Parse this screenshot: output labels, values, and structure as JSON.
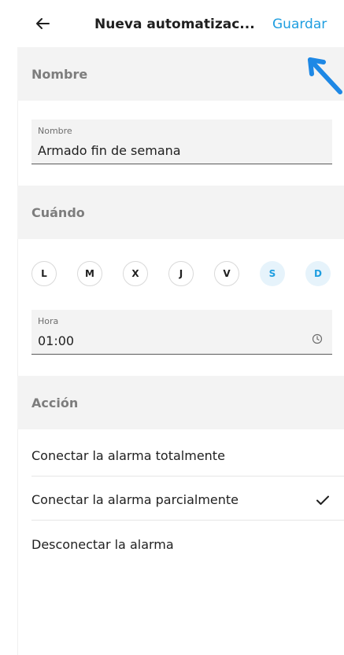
{
  "header": {
    "title": "Nueva automatizac...",
    "save_label": "Guardar"
  },
  "name_section": {
    "header": "Nombre",
    "field_label": "Nombre",
    "field_value": "Armado fin de semana"
  },
  "when_section": {
    "header": "Cuándo",
    "days": [
      {
        "label": "L",
        "selected": false
      },
      {
        "label": "M",
        "selected": false
      },
      {
        "label": "X",
        "selected": false
      },
      {
        "label": "J",
        "selected": false
      },
      {
        "label": "V",
        "selected": false
      },
      {
        "label": "S",
        "selected": true
      },
      {
        "label": "D",
        "selected": true
      }
    ],
    "time_label": "Hora",
    "time_value": "01:00"
  },
  "action_section": {
    "header": "Acción",
    "items": [
      {
        "label": "Conectar la alarma totalmente",
        "selected": false
      },
      {
        "label": "Conectar la alarma parcialmente",
        "selected": true
      },
      {
        "label": "Desconectar la alarma",
        "selected": false
      }
    ]
  },
  "colors": {
    "accent": "#1e9ee0",
    "selected_day_bg": "#e6f3fb",
    "section_bg": "#f3f3f3"
  }
}
